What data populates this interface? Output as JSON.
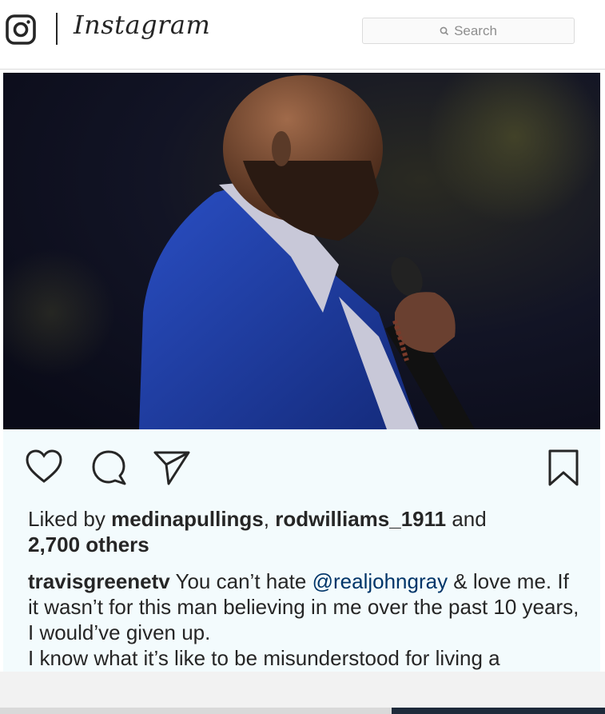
{
  "header": {
    "wordmark": "Instagram",
    "search_placeholder": "Search"
  },
  "post": {
    "likes_prefix": "Liked by ",
    "liker_1": "medinapullings",
    "separator": ", ",
    "liker_2": "rodwilliams_1911",
    "likes_and": " and",
    "likes_others": "2,700 others",
    "caption_user": "travisgreenetv",
    "caption_part1": " You can’t hate ",
    "caption_mention": "@realjohngray",
    "caption_part2": " & love me. If it wasn’t for this man believing in me over the past 10 years, I would’ve given up.",
    "caption_line2": "I know what it’s like to be misunderstood for living a"
  },
  "colors": {
    "panel_bg": "#f3fbfd",
    "mention": "#003569",
    "suit": "#1f3fa8"
  },
  "icons": [
    "instagram-glyph-icon",
    "search-icon",
    "heart-icon",
    "comment-icon",
    "share-icon",
    "bookmark-icon"
  ]
}
